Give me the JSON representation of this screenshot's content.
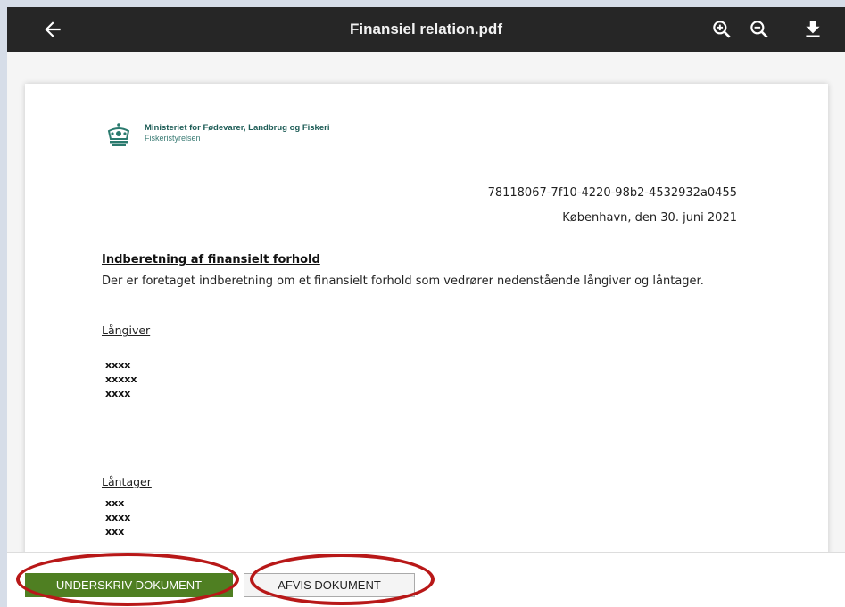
{
  "viewer": {
    "title": "Finansiel relation.pdf"
  },
  "document": {
    "org_name": "Ministeriet for Fødevarer, Landbrug og Fiskeri",
    "org_sub": "Fiskeristyrelsen",
    "doc_id": "78118067-7f10-4220-98b2-4532932a0455",
    "date_line": "København, den 30. juni 2021",
    "heading": "Indberetning af finansielt forhold",
    "intro": "Der er foretaget indberetning om et finansielt forhold som vedrører nedenstående långiver og låntager.",
    "lender_label": "Långiver",
    "lender_lines": [
      "xxxx",
      "xxxxx",
      "xxxx"
    ],
    "borrower_label": "Låntager",
    "borrower_lines": [
      "xxx",
      "xxxx",
      "xxx"
    ]
  },
  "actions": {
    "sign_label": "UNDERSKRIV DOKUMENT",
    "reject_label": "AFVIS DOKUMENT"
  },
  "colors": {
    "toolbar_bg": "#262626",
    "sign_button": "#4f7f22",
    "highlight_ring": "#b81818"
  },
  "icons": [
    "arrow-left-icon",
    "zoom-in-icon",
    "zoom-out-icon",
    "download-icon",
    "crown-logo"
  ]
}
